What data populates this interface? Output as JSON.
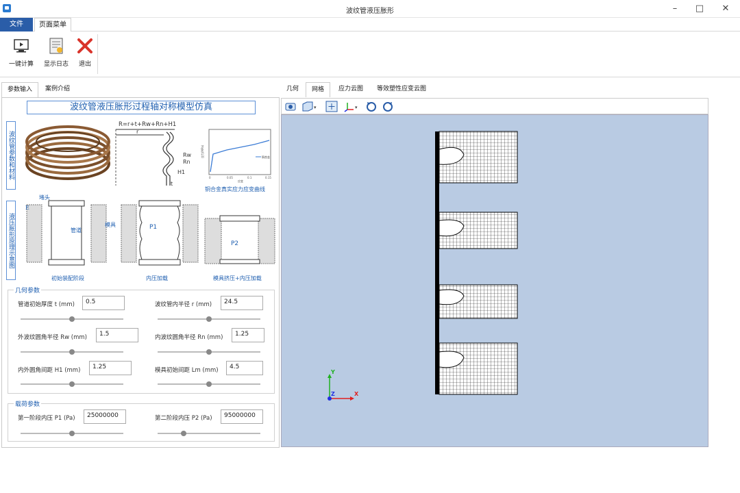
{
  "window": {
    "title": "波纹管液压胀形"
  },
  "ribbon": {
    "tabs": [
      "文件",
      "页面菜单"
    ],
    "buttons": {
      "compute": "一键计算",
      "log": "显示日志",
      "exit": "退出"
    }
  },
  "left_tabs": [
    "参数输入",
    "案例介绍"
  ],
  "figure": {
    "main_title": "波纹管液压胀形过程轴对称模型仿真",
    "vlabel_material": "波纹管参数和材料",
    "vlabel_principle": "液压胀形原理示意图",
    "formula": "R=r+t+Rw+Rn+H1",
    "r": "r",
    "Rw": "Rw",
    "Rn": "Rn",
    "H1": "H1",
    "t": "t",
    "curve_caption": "铜合金真实应力应变曲线",
    "curve_legend": "铜合金",
    "curve_xticks": [
      "0",
      "0.05",
      "0.1",
      "0.15"
    ],
    "curve_xlabel": "应变",
    "curve_ylabel": "应力(MPa)",
    "label_cap": "堵头",
    "label_E": "E",
    "label_pipe": "管道",
    "label_die": "模具",
    "label_P1": "P1",
    "label_P2": "P2",
    "stage1": "初始装配阶段",
    "stage2": "内压加载",
    "stage3": "模具挤压+内压加载"
  },
  "geometry_group": {
    "title": "几何参数",
    "params": [
      {
        "label": "管道初始厚度 t (mm)",
        "value": "0.5",
        "slider": 0.5
      },
      {
        "label": "波纹管内半径 r (mm)",
        "value": "24.5",
        "slider": 0.5
      },
      {
        "label": "外波纹圆角半径 Rw (mm)",
        "value": "1.5",
        "slider": 0.5
      },
      {
        "label": "内波纹圆角半径 Rn (mm)",
        "value": "1.25",
        "slider": 0.5
      },
      {
        "label": "内外圆角间距 H1 (mm)",
        "value": "1.25",
        "slider": 0.5
      },
      {
        "label": "模具初始间距 Lm (mm)",
        "value": "4.5",
        "slider": 0.5
      }
    ]
  },
  "load_group": {
    "title": "载荷参数",
    "params": [
      {
        "label": "第一阶段内压 P1 (Pa)",
        "value": "25000000",
        "slider": 0.5
      },
      {
        "label": "第二阶段内压 P2 (Pa)",
        "value": "95000000",
        "slider": 0.25
      }
    ]
  },
  "right_tabs": [
    "几何",
    "网格",
    "应力云图",
    "等效塑性应变云图"
  ],
  "viewport": {
    "background": "#b9cbe3",
    "axis_labels": {
      "x": "X",
      "y": "Y",
      "z": "Z"
    }
  },
  "colors": {
    "accent": "#2a5da8",
    "label_blue": "#1f5fb0",
    "x_axis": "#e02020",
    "y_axis": "#20b020",
    "z_axis": "#2030e0"
  }
}
